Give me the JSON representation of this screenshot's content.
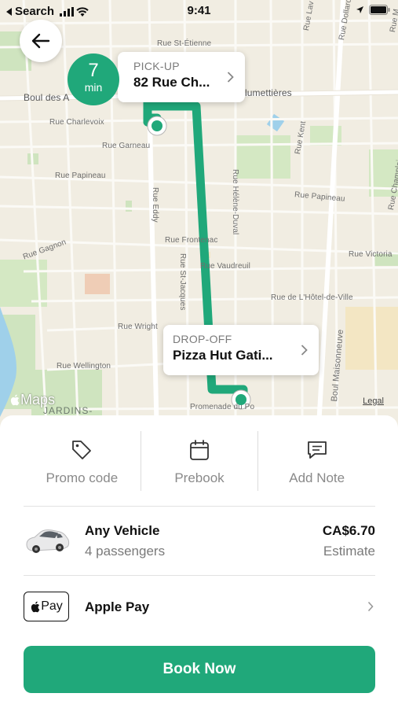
{
  "status_bar": {
    "back_app": "Search",
    "time": "9:41",
    "icons": [
      "signal-icon",
      "wifi-icon",
      "location-arrow-icon",
      "battery-icon"
    ]
  },
  "map": {
    "back_icon": "arrow-left-icon",
    "eta": {
      "value": "7",
      "unit": "min"
    },
    "pickup": {
      "caption": "PICK-UP",
      "address": "82 Rue Ch..."
    },
    "dropoff": {
      "caption": "DROP-OFF",
      "address": "Pizza Hut Gati..."
    },
    "attribution": "Maps",
    "legal": "Legal",
    "district": "JARDINS-",
    "streets": {
      "st_etienne": "Rue St-Étienne",
      "boul_des": "Boul des A",
      "allumettieres": "lumettières",
      "charlevoix": "Rue Charlevoix",
      "garneau": "Rue Garneau",
      "papineau_w": "Rue Papineau",
      "papineau_e": "Rue Papineau",
      "gagnon": "Rue Gagnon",
      "frontenac": "Rue Frontenac",
      "vaudreuil": "Rue Vaudreuil",
      "hotel_de_ville": "Rue de L'Hôtel-de-Ville",
      "wright": "Rue Wright",
      "wellington": "Rue Wellington",
      "victoria": "Rue Victoria",
      "eddy": "Rue Eddy",
      "st_jacques": "Rue St-Jacques",
      "helene_duval": "Rue Hélène-Duval",
      "kent": "Rue Kent",
      "maisonneuve": "Boul Maisonneuve",
      "dollard": "Rue Dollard-d",
      "champlain": "Rue Champlai",
      "laval": "Rue Lav",
      "prom": "Promenade du Po",
      "rue_m": "Rue M"
    },
    "route_color": "#20a87a"
  },
  "options": [
    {
      "label": "Promo code",
      "icon": "tag-icon"
    },
    {
      "label": "Prebook",
      "icon": "calendar-icon"
    },
    {
      "label": "Add Note",
      "icon": "note-icon"
    }
  ],
  "vehicle": {
    "name": "Any Vehicle",
    "passengers": "4 passengers",
    "price": "CA$6.70",
    "price_note": "Estimate",
    "icon": "car-image"
  },
  "payment": {
    "badge": "Pay",
    "badge_icon": "apple-logo-icon",
    "label": "Apple Pay",
    "chevron_icon": "chevron-right-icon"
  },
  "book_button": {
    "label": "Book Now",
    "color": "#20a87a"
  }
}
